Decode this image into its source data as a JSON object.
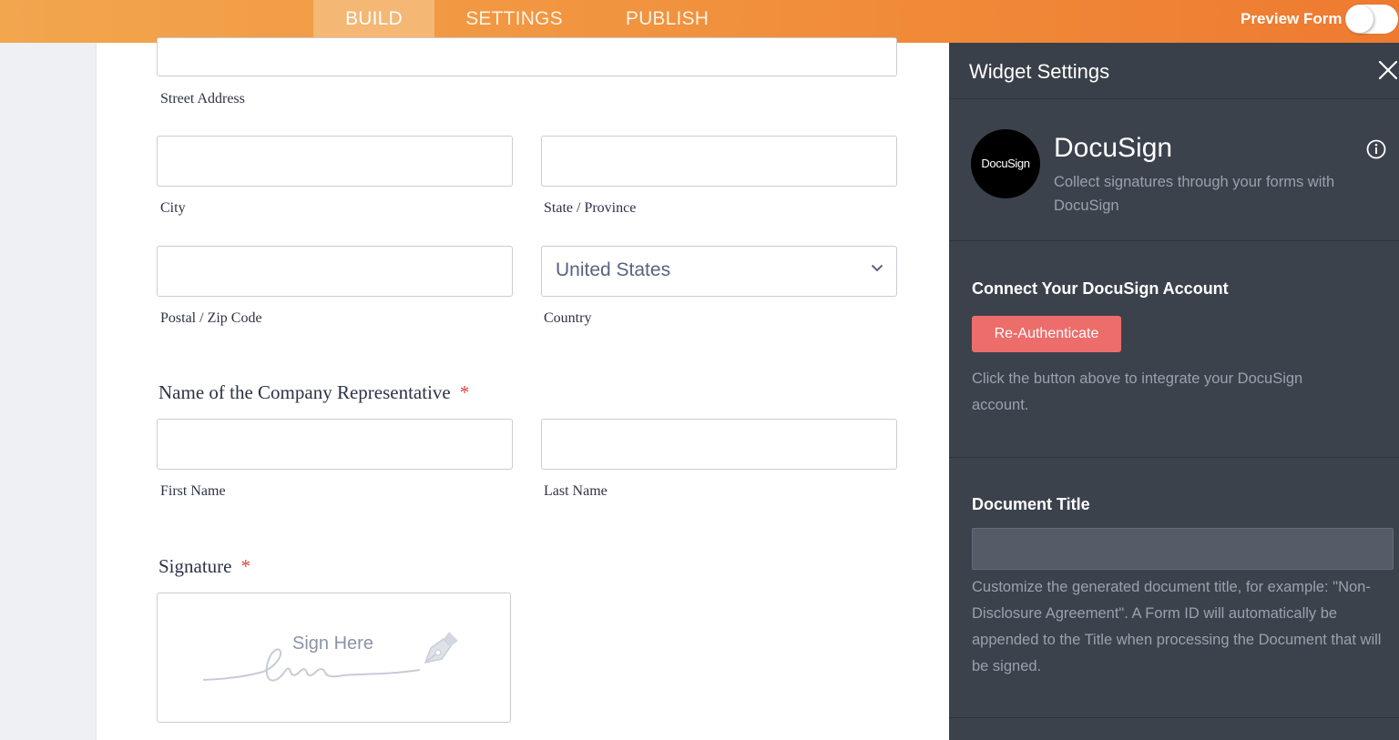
{
  "topbar": {
    "tabs": [
      "BUILD",
      "SETTINGS",
      "PUBLISH"
    ],
    "active_tab": "BUILD",
    "preview_label": "Preview Form",
    "preview_enabled": false
  },
  "form": {
    "street_label": "Street Address",
    "city_label": "City",
    "state_label": "State / Province",
    "postal_label": "Postal / Zip Code",
    "country_label": "Country",
    "country_value": "United States",
    "company_rep_label": "Name of the Company Representative",
    "required_mark": "*",
    "first_name_label": "First Name",
    "last_name_label": "Last Name",
    "signature_label": "Signature",
    "sign_here": "Sign Here"
  },
  "panel": {
    "title": "Widget Settings",
    "widget_logo_text": "DocuSign",
    "widget_name": "DocuSign",
    "widget_desc": "Collect signatures through your forms with DocuSign",
    "connect_heading": "Connect Your DocuSign Account",
    "reauth_label": "Re-Authenticate",
    "connect_help": "Click the button above to integrate your DocuSign account.",
    "doc_title_heading": "Document Title",
    "doc_title_value": "",
    "doc_title_help": "Customize the generated document title, for example: \"Non-Disclosure Agreement\". A Form ID will automatically be appended to the Title when processing the Document that will be signed."
  },
  "colors": {
    "brand_orange": "#f18f3c",
    "panel_bg": "#3c424c",
    "reauth_button": "#ed6d6b",
    "required_red": "#e23f3f"
  },
  "icons": [
    "close-icon",
    "info-icon",
    "chevron-down-icon",
    "pen-icon",
    "toggle-switch"
  ]
}
